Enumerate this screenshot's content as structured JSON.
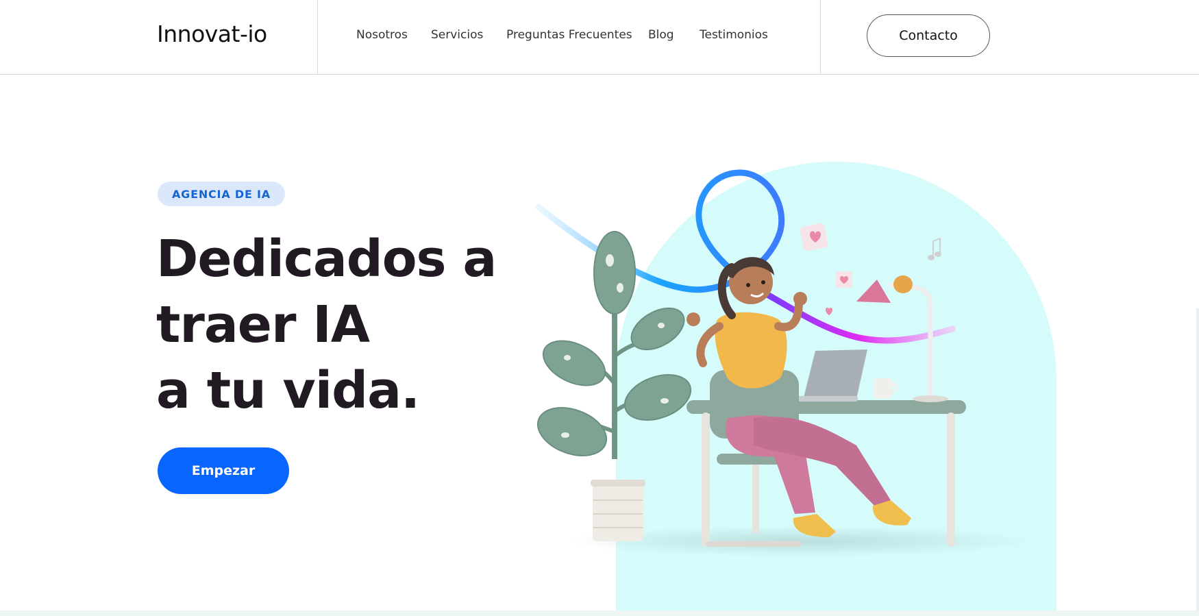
{
  "header": {
    "logo": "Innovat-io",
    "nav": [
      {
        "label": "Nosotros"
      },
      {
        "label": "Servicios"
      },
      {
        "label": "Preguntas Frecuentes"
      },
      {
        "label": "Blog"
      },
      {
        "label": "Testimonios"
      }
    ],
    "contact_label": "Contacto"
  },
  "hero": {
    "badge": "AGENCIA DE IA",
    "headline_lines": [
      "Dedicados a",
      "traer IA",
      "a tu vida."
    ],
    "cta_label": "Empezar"
  },
  "colors": {
    "primary": "#0866ff",
    "badge_bg": "#dbe8fb",
    "badge_text": "#1565d0",
    "headline": "#211a23",
    "arch": "#d6fbfb"
  },
  "illustration": {
    "icon": "woman-at-desk-illustration"
  }
}
